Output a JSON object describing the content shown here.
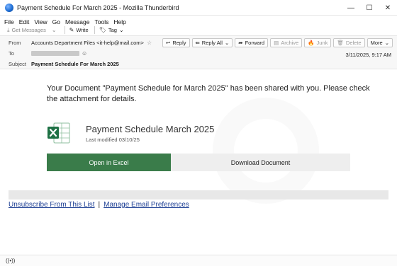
{
  "window": {
    "title": "Payment Schedule For March 2025 - Mozilla Thunderbird",
    "controls": [
      "—",
      "☐",
      "✕"
    ]
  },
  "menu": [
    "File",
    "Edit",
    "View",
    "Go",
    "Message",
    "Tools",
    "Help"
  ],
  "toolbar": {
    "get_messages": "Get Messages",
    "write": "Write",
    "tag": "Tag"
  },
  "header": {
    "from_label": "From",
    "from_value": "Accounts Department Files <it-help@mail.com>",
    "to_label": "To",
    "subject_label": "Subject",
    "subject_value": "Payment Schedule For March 2025",
    "date": "3/11/2025, 9:17 AM",
    "actions": {
      "reply": "Reply",
      "reply_all": "Reply All",
      "forward": "Forward",
      "archive": "Archive",
      "junk": "Junk",
      "delete": "Delete",
      "more": "More"
    }
  },
  "email": {
    "intro": "Your Document \"Payment Schedule for March 2025\" has been shared with you. Please check the attachment for details.",
    "doc_title": "Payment Schedule March 2025",
    "doc_meta": "Last modified 03/10/25",
    "open_button": "Open in Excel",
    "download_button": "Download Document",
    "unsubscribe": "Unsubscribe From This List",
    "separator": "|",
    "preferences": "Manage Email Preferences"
  },
  "colors": {
    "open_button": "#3a7c4a",
    "link": "#1d3f94",
    "excel_green": "#1e7145"
  }
}
